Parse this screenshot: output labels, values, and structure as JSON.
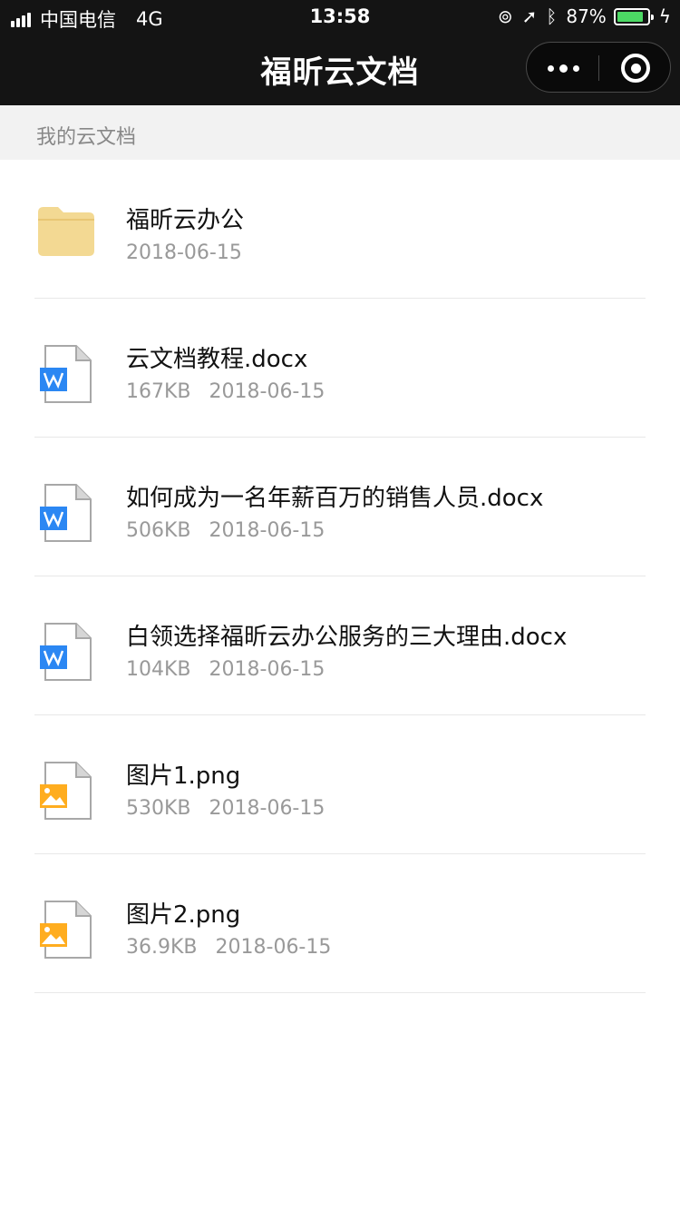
{
  "status_bar": {
    "carrier": "中国电信",
    "network": "4G",
    "time": "13:58",
    "battery_percent": "87%",
    "battery_level": 0.87,
    "icons": [
      "signal-icon",
      "lock-rotation-icon",
      "location-icon",
      "bluetooth-icon",
      "battery-icon",
      "charging-icon"
    ]
  },
  "nav": {
    "title": "福昕云文档",
    "more_icon": "more-dots-icon",
    "close_icon": "close-ring-icon"
  },
  "section": {
    "label": "我的云文档"
  },
  "colors": {
    "topbar": "#141414",
    "folder": "#f3d993",
    "word_blue": "#2b87f3",
    "image_orange": "#ffad1f",
    "battery_green": "#4cd964"
  },
  "files": [
    {
      "name": "福昕云办公",
      "size": "",
      "date": "2018-06-15",
      "icon": "folder-icon"
    },
    {
      "name": "云文档教程.docx",
      "size": "167KB",
      "date": "2018-06-15",
      "icon": "word-doc-icon"
    },
    {
      "name": "如何成为一名年薪百万的销售人员.docx",
      "size": "506KB",
      "date": "2018-06-15",
      "icon": "word-doc-icon"
    },
    {
      "name": "白领选择福昕云办公服务的三大理由.docx",
      "size": "104KB",
      "date": "2018-06-15",
      "icon": "word-doc-icon"
    },
    {
      "name": "图片1.png",
      "size": "530KB",
      "date": "2018-06-15",
      "icon": "image-file-icon"
    },
    {
      "name": "图片2.png",
      "size": "36.9KB",
      "date": "2018-06-15",
      "icon": "image-file-icon"
    }
  ]
}
